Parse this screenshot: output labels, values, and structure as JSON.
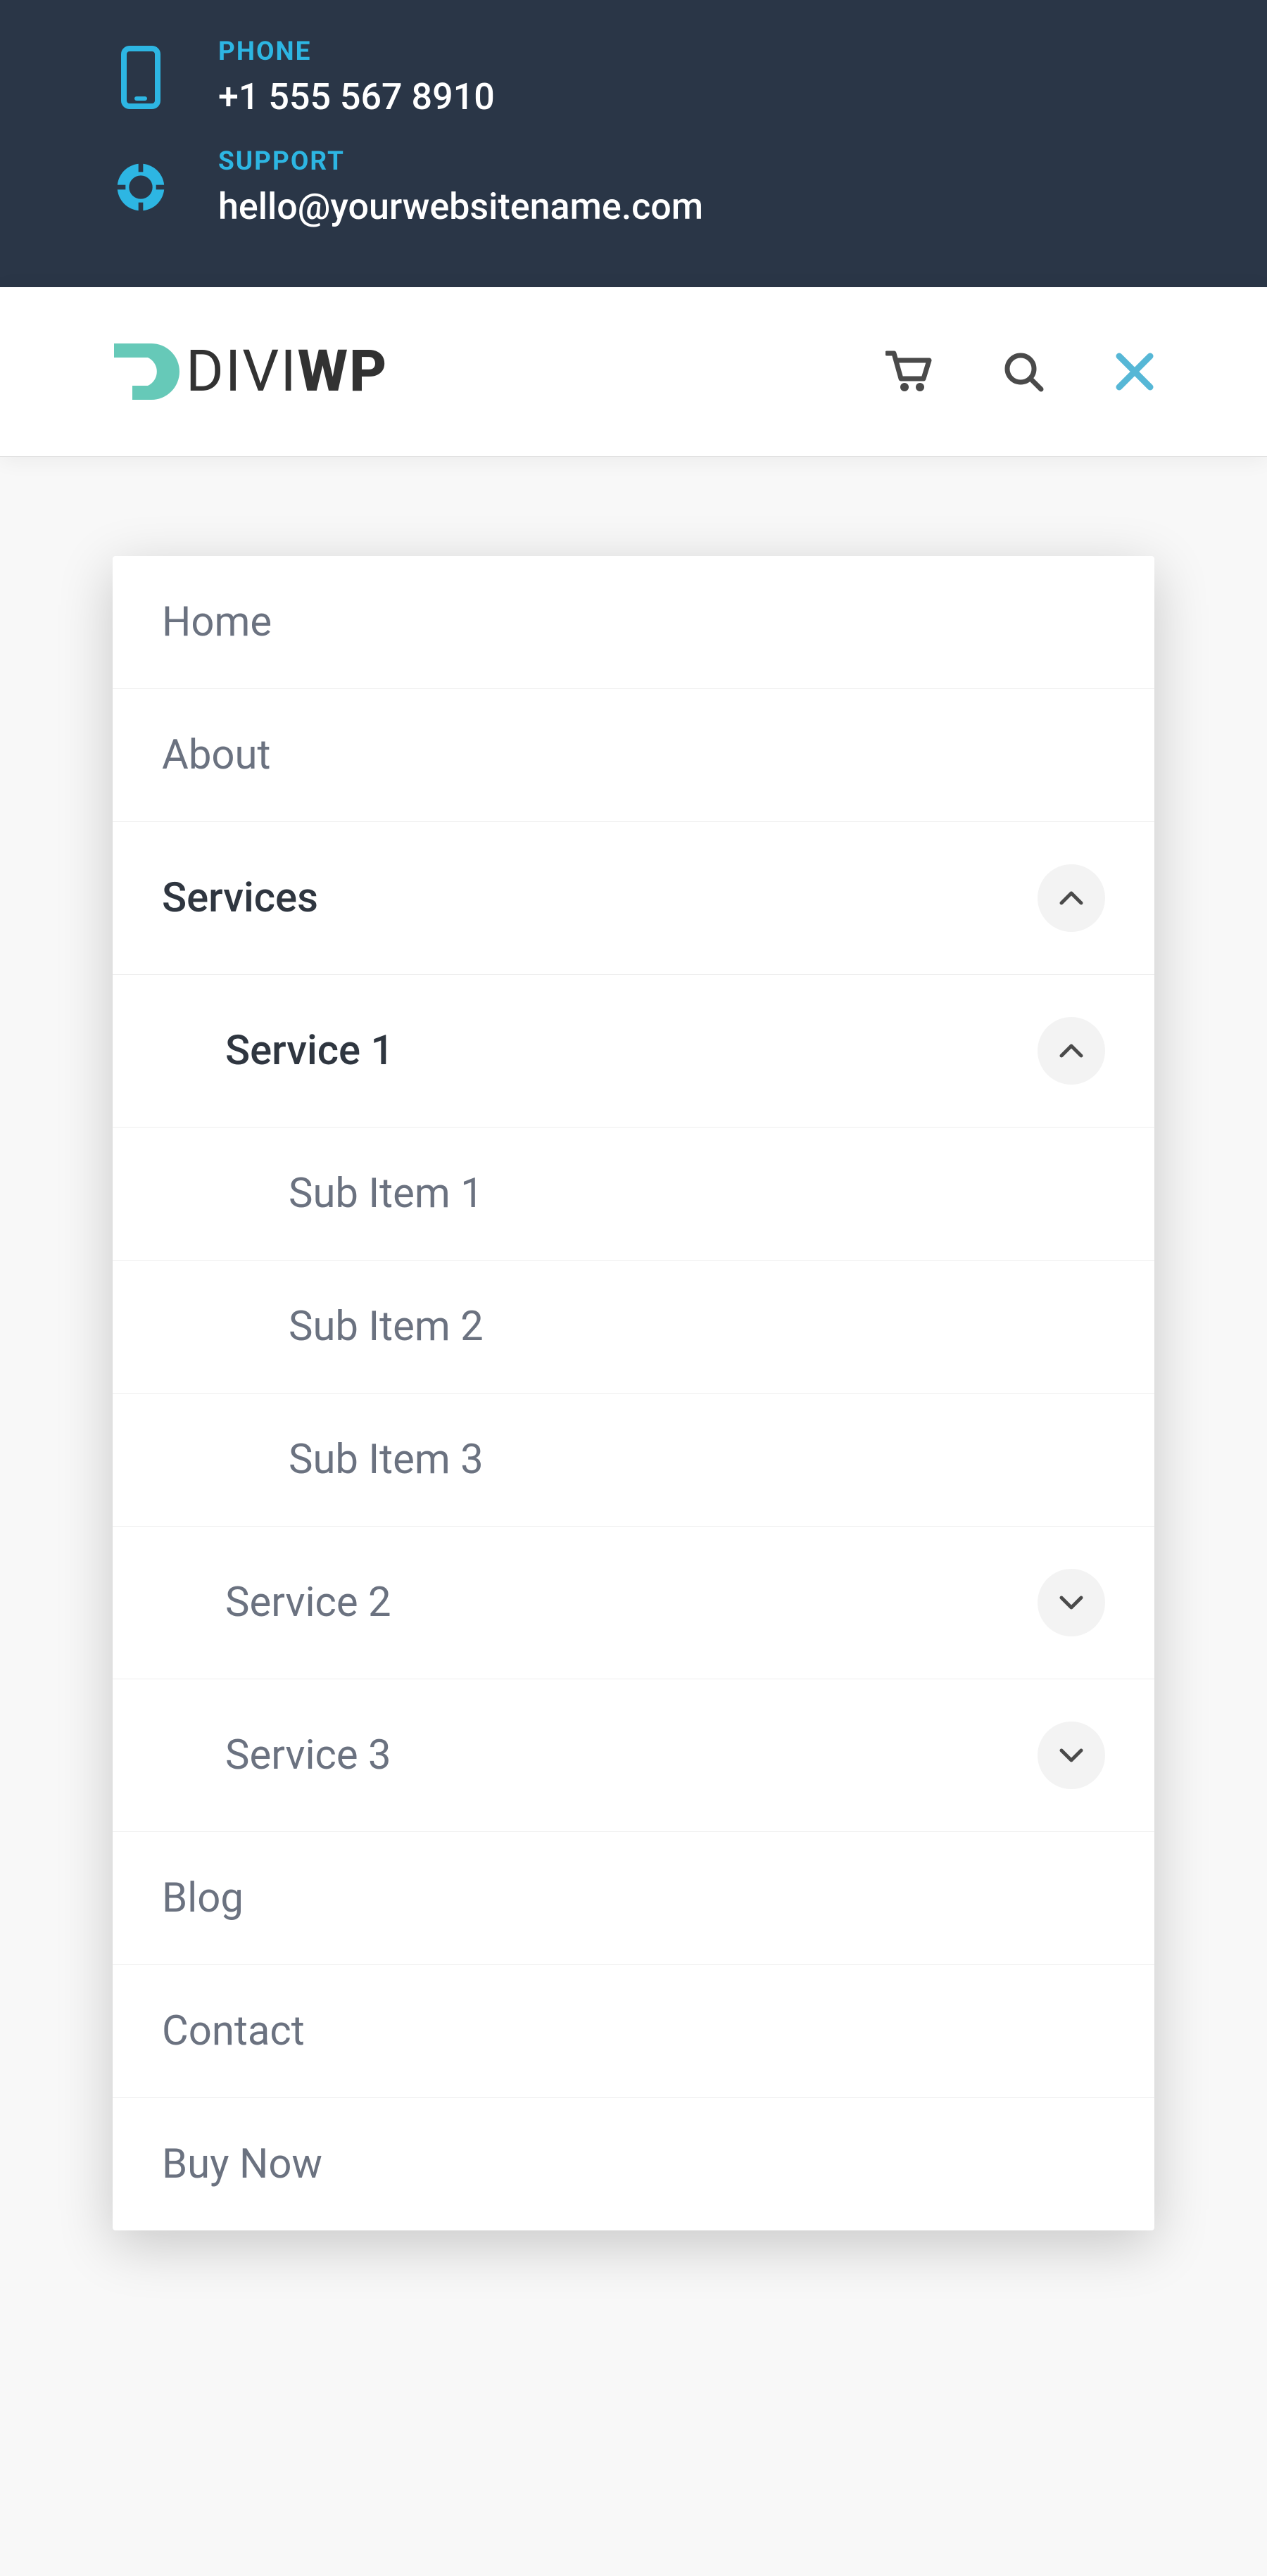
{
  "topbar": {
    "phone": {
      "label": "PHONE",
      "value": "+1 555 567 8910"
    },
    "support": {
      "label": "SUPPORT",
      "value": "hello@yourwebsitename.com"
    }
  },
  "logo": {
    "part1": "DIVI",
    "part2": "WP"
  },
  "menu": {
    "home": "Home",
    "about": "About",
    "services": "Services",
    "service1": "Service 1",
    "sub1": "Sub Item 1",
    "sub2": "Sub Item 2",
    "sub3": "Sub Item 3",
    "service2": "Service 2",
    "service3": "Service 3",
    "blog": "Blog",
    "contact": "Contact",
    "buynow": "Buy Now"
  }
}
